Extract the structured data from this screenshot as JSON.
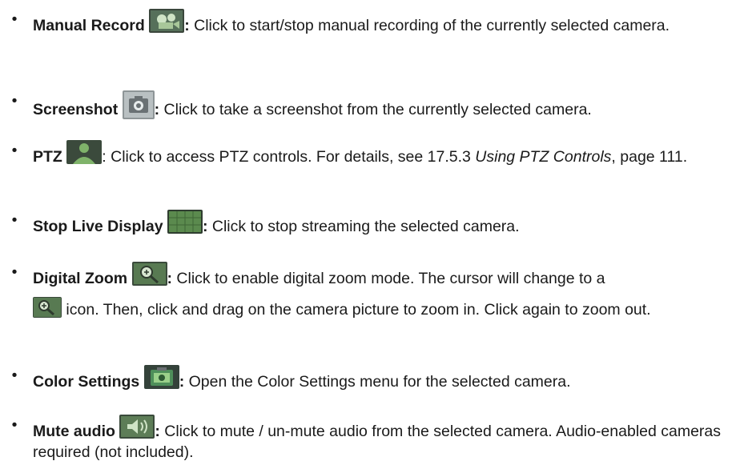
{
  "bullet_char": "•",
  "items": [
    {
      "label": "Manual Record",
      "icon": "film-camera-icon",
      "sep": ":",
      "text": " Click to start/stop manual recording of the currently selected camera."
    },
    {
      "label": "Screenshot",
      "icon": "camera-icon",
      "sep": ":",
      "text": " Click to take a screenshot from the currently selected camera."
    },
    {
      "label": "PTZ",
      "icon": "person-icon",
      "sep": ":",
      "text_before": " Click to access PTZ controls. For details, see 17.5.3 ",
      "italic": "Using PTZ Controls",
      "text_after": ", page 111."
    },
    {
      "label": "Stop Live Display",
      "icon": "grid-screen-icon",
      "sep": ":",
      "text": " Click to stop streaming the selected camera."
    },
    {
      "label": "Digital Zoom",
      "icon": "zoom-in-icon",
      "sep": ":",
      "text": " Click to enable digital zoom mode. The cursor will change to a",
      "text_line2": " icon. Then, click and drag on the camera picture to zoom in. Click again to zoom out."
    },
    {
      "label": "Color Settings",
      "icon": "color-settings-icon",
      "sep": ":",
      "text": " Open the Color Settings menu for the selected camera."
    },
    {
      "label": "Mute audio",
      "icon": "speaker-icon",
      "sep": ":",
      "text": " Click to mute / un-mute audio from the selected camera. Audio-enabled cameras required (not included)."
    }
  ],
  "colors": {
    "icon_bg_dark": "#2f3a2e",
    "icon_green": "#6fa45a",
    "icon_gray": "#9aa3a8"
  }
}
